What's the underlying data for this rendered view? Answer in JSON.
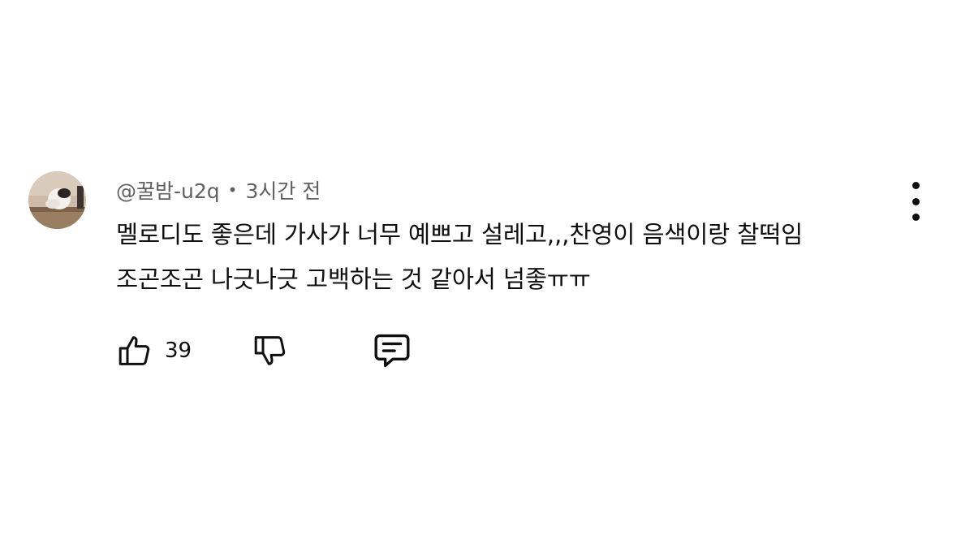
{
  "comment": {
    "author": "@꿀밤-u2q",
    "separator": "•",
    "time": "3시간 전",
    "text": "멜로디도 좋은데 가사가 너무 예쁘고 설레고,,,찬영이 음색이랑 찰떡임\n조곤조곤 나긋나긋 고백하는 것 같아서 넘좋ㅠㅠ",
    "likes": "39"
  },
  "icons": {
    "avatar": "profile-photo",
    "like": "thumbs-up-icon",
    "dislike": "thumbs-down-icon",
    "reply": "comment-bubble-icon",
    "menu": "more-vertical-icon"
  },
  "colors": {
    "text": "#0f0f0f",
    "meta": "#606060",
    "background": "#ffffff"
  }
}
